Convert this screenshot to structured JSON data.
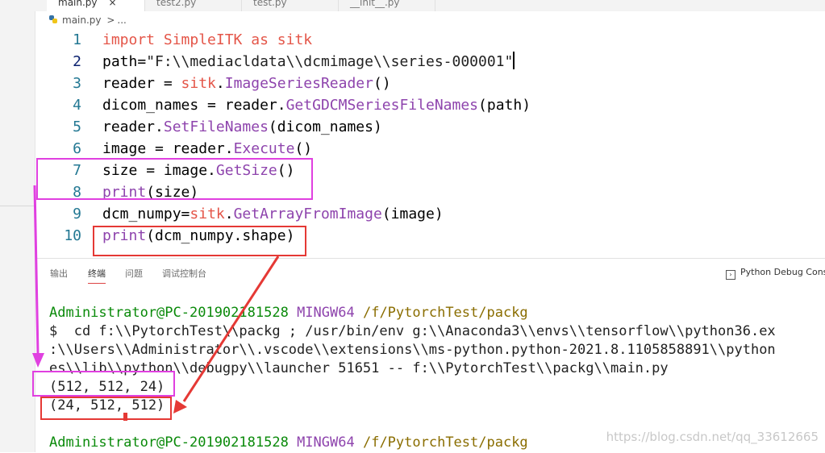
{
  "tabs": [
    {
      "label": "main.py",
      "active": true,
      "close": "×"
    },
    {
      "label": "test2.py",
      "active": false
    },
    {
      "label": "test.py",
      "active": false
    },
    {
      "label": "__init__.py",
      "active": false
    }
  ],
  "breadcrumb": {
    "file": "main.py",
    "sep": ">",
    "more": "..."
  },
  "code_lines": [
    {
      "n": "1",
      "parts": [
        [
          "kw",
          "import "
        ],
        [
          "mod",
          "SimpleITK"
        ],
        [
          "tx",
          " "
        ],
        [
          "kw",
          "as "
        ],
        [
          "mod",
          "sitk"
        ]
      ]
    },
    {
      "n": "2",
      "parts": [
        [
          "tx",
          "path"
        ],
        [
          "tx",
          "="
        ],
        [
          "st",
          "\"F:\\\\mediacldata\\\\dcmimage\\\\series-000001\""
        ]
      ]
    },
    {
      "n": "3",
      "parts": [
        [
          "tx",
          "reader "
        ],
        [
          "tx",
          "= "
        ],
        [
          "mod",
          "sitk"
        ],
        [
          "tx",
          "."
        ],
        [
          "fn",
          "ImageSeriesReader"
        ],
        [
          "tx",
          "()"
        ]
      ]
    },
    {
      "n": "4",
      "parts": [
        [
          "tx",
          "dicom_names "
        ],
        [
          "tx",
          "= "
        ],
        [
          "tx",
          "reader."
        ],
        [
          "fn",
          "GetGDCMSeriesFileNames"
        ],
        [
          "tx",
          "(path)"
        ]
      ]
    },
    {
      "n": "5",
      "parts": [
        [
          "tx",
          "reader."
        ],
        [
          "fn",
          "SetFileNames"
        ],
        [
          "tx",
          "(dicom_names)"
        ]
      ]
    },
    {
      "n": "6",
      "parts": [
        [
          "tx",
          "image "
        ],
        [
          "tx",
          "= "
        ],
        [
          "tx",
          "reader."
        ],
        [
          "fn",
          "Execute"
        ],
        [
          "tx",
          "()"
        ]
      ]
    },
    {
      "n": "7",
      "parts": [
        [
          "tx",
          "size "
        ],
        [
          "tx",
          "= "
        ],
        [
          "tx",
          "image."
        ],
        [
          "fn",
          "GetSize"
        ],
        [
          "tx",
          "()"
        ]
      ]
    },
    {
      "n": "8",
      "parts": [
        [
          "fn",
          "print"
        ],
        [
          "tx",
          "(size)"
        ]
      ]
    },
    {
      "n": "9",
      "parts": [
        [
          "tx",
          "dcm_numpy"
        ],
        [
          "tx",
          "="
        ],
        [
          "mod",
          "sitk"
        ],
        [
          "tx",
          "."
        ],
        [
          "fn",
          "GetArrayFromImage"
        ],
        [
          "tx",
          "(image)"
        ]
      ]
    },
    {
      "n": "10",
      "parts": [
        [
          "fn",
          "print"
        ],
        [
          "tx",
          "(dcm_numpy.shape)"
        ]
      ]
    }
  ],
  "panel": {
    "tabs": [
      "输出",
      "终端",
      "问题",
      "调试控制台"
    ],
    "active_tab": "终端",
    "debug_select": "Python Debug Console"
  },
  "terminal": {
    "prompt1": {
      "user": "Administrator@PC-201902181528",
      "env": "MINGW64",
      "path": "/f/PytorchTest/packg"
    },
    "cmd_lines": [
      "$  cd f:\\\\PytorchTest\\\\packg ; /usr/bin/env g:\\\\Anaconda3\\\\envs\\\\tensorflow\\\\python36.ex",
      ":\\\\Users\\\\Administrator\\\\.vscode\\\\extensions\\\\ms-python.python-2021.8.1105858891\\\\python",
      "es\\\\lib\\\\python\\\\debugpy\\\\launcher 51651 -- f:\\\\PytorchTest\\\\packg\\\\main.py"
    ],
    "output1": "(512, 512, 24)",
    "output2": "(24, 512, 512)",
    "prompt2": {
      "user": "Administrator@PC-201902181528",
      "env": "MINGW64",
      "path": "/f/PytorchTest/packg"
    }
  },
  "watermark": "https://blog.csdn.net/qq_33612665",
  "colors": {
    "magenta": "#e040e0",
    "red": "#e53935"
  }
}
